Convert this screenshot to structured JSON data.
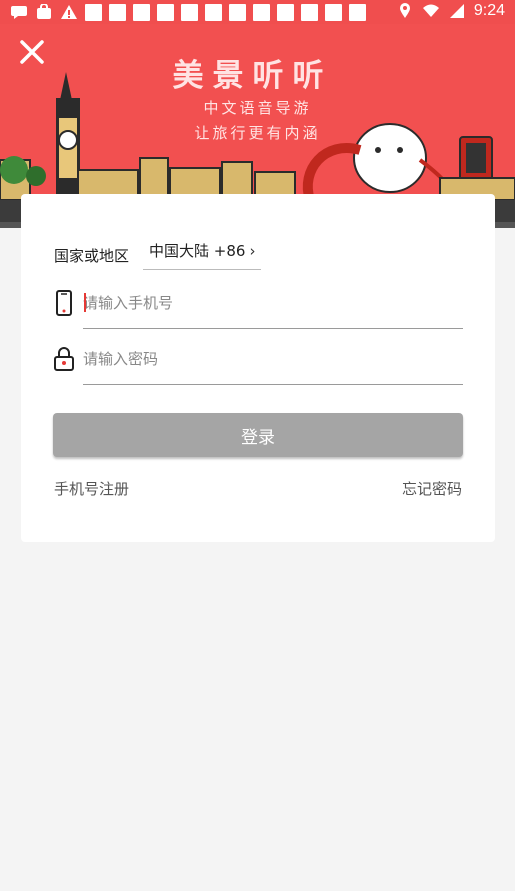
{
  "status_bar": {
    "time": "9:24"
  },
  "banner": {
    "title": "美景听听",
    "subtitle_line1": "中文语音导游",
    "subtitle_line2": "让旅行更有内涵"
  },
  "login": {
    "region_label": "国家或地区",
    "region_value": "中国大陆 +86",
    "phone_placeholder": "请输入手机号",
    "password_placeholder": "请输入密码",
    "login_button": "登录",
    "register_link": "手机号注册",
    "forgot_link": "忘记密码"
  },
  "colors": {
    "brand_red": "#f25050",
    "button_gray": "#a5a5a5"
  }
}
